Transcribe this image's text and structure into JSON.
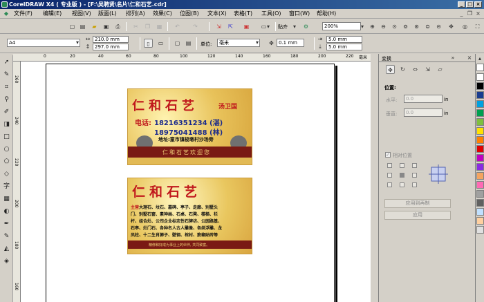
{
  "title_bar": {
    "text": "CorelDRAW X4 ( 专业版 ) - [F:\\吴聘贤\\名片\\仁和石艺.cdr]",
    "controls": [
      "_",
      "□",
      "×"
    ]
  },
  "menu": [
    "文件(F)",
    "编辑(E)",
    "视图(V)",
    "版面(L)",
    "排列(A)",
    "效果(C)",
    "位图(B)",
    "文本(X)",
    "表格(T)",
    "工具(O)",
    "窗口(W)",
    "帮助(H)"
  ],
  "std_toolbar": {
    "snap_label": "贴齐",
    "zoom": "200%"
  },
  "prop_bar": {
    "paper": "A4",
    "width": "210.0 mm",
    "height": "297.0 mm",
    "units_label": "单位:",
    "units": "毫米",
    "nudge": "0.1 mm",
    "dup_x": "5.0 mm",
    "dup_y": "5.0 mm"
  },
  "hruler": {
    "labels": [
      "0",
      "20",
      "40",
      "60",
      "80",
      "100",
      "120",
      "140",
      "160",
      "180",
      "200",
      "220"
    ],
    "unit": "毫米"
  },
  "vruler": {
    "labels": [
      "260",
      "240",
      "220",
      "200",
      "180",
      "160"
    ]
  },
  "card1": {
    "brand": "仁和石艺",
    "founder": "汤卫国",
    "phone_label": "电话:",
    "phone1": "18216351234 (湛)",
    "phone2": "18975041488 (林)",
    "address": "地址:童市镇梭墩村沙场旁",
    "banner": "仁和石艺欢迎您"
  },
  "card2": {
    "brand": "仁和石艺",
    "main_label": "主营",
    "services": [
      "大理石、坟石、墓碑、亭子、走廊、别墅头",
      "门、别墅石窗、素神画、石桌、石凳、楼梯、栏",
      "杆、组合灶、公司企业标志性石牌坊、公园路基、",
      "石亭、灶门石、各种名人古人雕像、各类浮雕、龙",
      "凤柱、十二生肖狮子、壁钢、棺材、筋箱贴砖等"
    ],
    "footer": "精修和好成为事业上的伙伴, 共同致富。"
  },
  "docker": {
    "tab": "变换",
    "position_label": "位置:",
    "h_label": "水平:",
    "h_value": "0.0",
    "v_label": "垂直:",
    "v_value": "0.0",
    "unit": "in",
    "relative_label": "相对位置",
    "apply_dup_label": "应用到再制",
    "apply_label": "应用"
  },
  "palette": [
    "#ffffff",
    "#000000",
    "#1a3c8f",
    "#00a0e0",
    "#00a050",
    "#7fbf3f",
    "#ffe000",
    "#ff8000",
    "#e00000",
    "#c000c0",
    "#8a2be2",
    "#f4a460",
    "#ff69b4",
    "#a0a0a0",
    "#606060",
    "#c0e0ff",
    "#ffd0a0",
    "#e0e0e0"
  ],
  "colors": {
    "title_start": "#0a246a",
    "title_end": "#3a6ea5",
    "brand_red": "#c0181c",
    "phone_blue": "#1a2a8c"
  }
}
